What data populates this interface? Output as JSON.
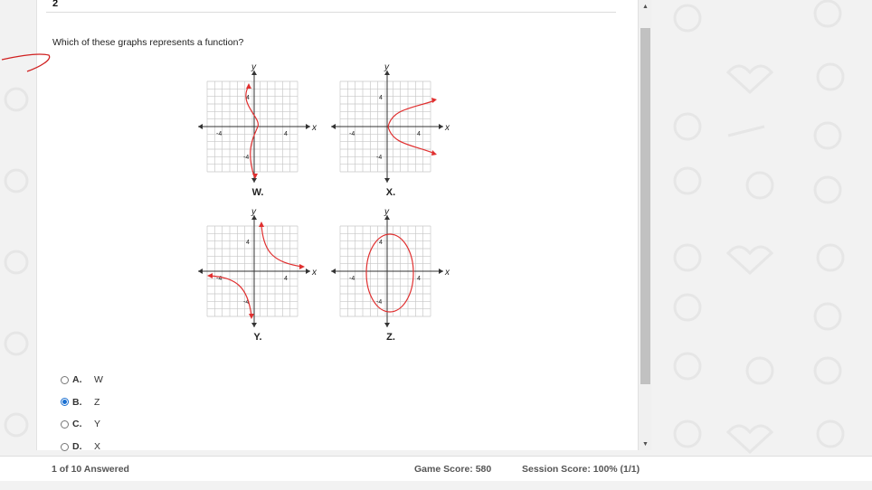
{
  "question": {
    "number": "2",
    "prompt": "Which of these graphs represents a function?"
  },
  "graphs": [
    {
      "label": "W.",
      "axis_x": "x",
      "axis_y": "y",
      "tick_pos": "4",
      "tick_neg": "-4"
    },
    {
      "label": "X.",
      "axis_x": "x",
      "axis_y": "y",
      "tick_pos": "4",
      "tick_neg": "-4"
    },
    {
      "label": "Y.",
      "axis_x": "x",
      "axis_y": "y",
      "tick_pos": "4",
      "tick_neg": "-4"
    },
    {
      "label": "Z.",
      "axis_x": "x",
      "axis_y": "y",
      "tick_pos": "4",
      "tick_neg": "-4"
    }
  ],
  "choices": [
    {
      "letter": "A.",
      "text": "W",
      "selected": false
    },
    {
      "letter": "B.",
      "text": "Z",
      "selected": true
    },
    {
      "letter": "C.",
      "text": "Y",
      "selected": false
    },
    {
      "letter": "D.",
      "text": "X",
      "selected": false
    }
  ],
  "footer": {
    "answered": "1 of 10 Answered",
    "game_score": "Game Score: 580",
    "session_score": "Session Score: 100% (1/1)"
  },
  "colors": {
    "curve": "#e03030",
    "pen_mark": "#d02020",
    "radio_selected": "#1a6fd1"
  },
  "icons": {
    "scroll_up": "scroll-up-arrow-icon",
    "scroll_down": "scroll-down-arrow-icon"
  }
}
